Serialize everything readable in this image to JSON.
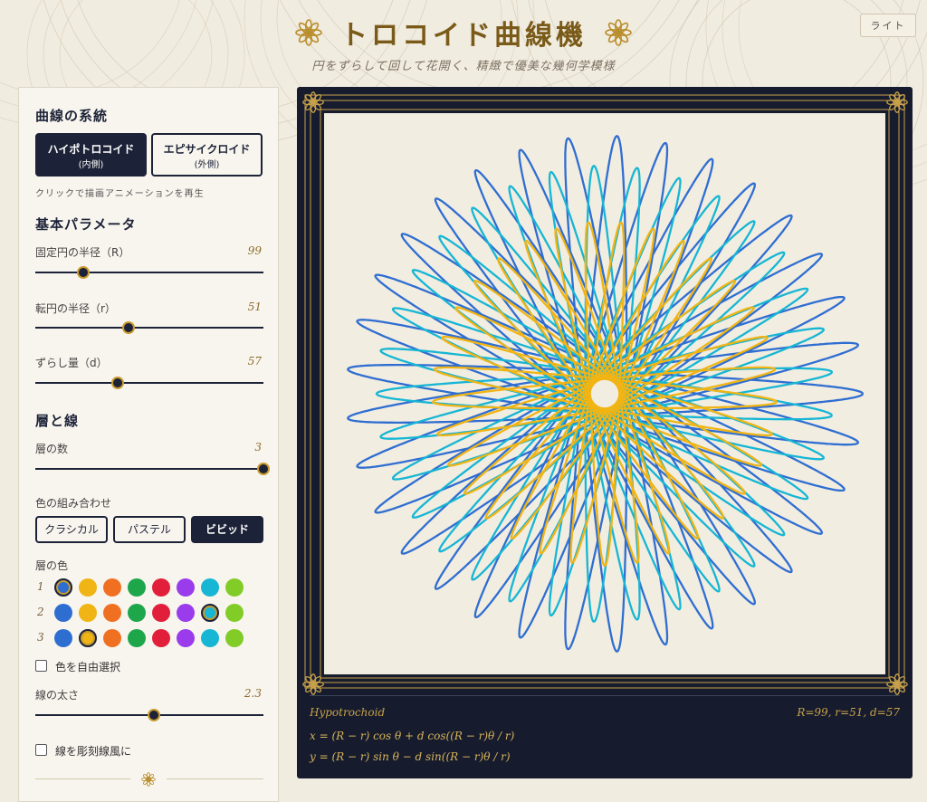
{
  "header": {
    "title": "トロコイド曲線機",
    "subtitle": "円をずらして回して花開く、精緻で優美な幾何学模様",
    "theme_button": "ライト"
  },
  "panel": {
    "family": {
      "title": "曲線の系統",
      "hypo_label": "ハイポトロコイド",
      "hypo_sub": "(内側)",
      "epi_label": "エピサイクロイド",
      "epi_sub": "(外側)",
      "selected": "hypo",
      "hint": "クリックで描画アニメーションを再生"
    },
    "basic": {
      "title": "基本パラメータ",
      "R_label": "固定円の半径（R）",
      "R_value": "99",
      "r_label": "転円の半径（r）",
      "r_value": "51",
      "d_label": "ずらし量（d）",
      "d_value": "57",
      "R_fraction": 0.21,
      "r_fraction": 0.41,
      "d_fraction": 0.36
    },
    "layers": {
      "title": "層と線",
      "count_label": "層の数",
      "count_value": "3",
      "count_fraction": 1.0,
      "combo_label": "色の組み合わせ",
      "combo_classic": "クラシカル",
      "combo_pastel": "パステル",
      "combo_vivid": "ビビッド",
      "combo_selected": "vivid",
      "colors_label": "層の色",
      "palette": [
        "#2f6ed1",
        "#f0b414",
        "#f07022",
        "#1ea64a",
        "#e21f3a",
        "#9a3bec",
        "#16b6d4",
        "#82cc28"
      ],
      "rows": [
        {
          "num": "1",
          "selected": 0
        },
        {
          "num": "2",
          "selected": 6
        },
        {
          "num": "3",
          "selected": 1
        }
      ],
      "free_color_label": "色を自由選択",
      "width_label": "線の太さ",
      "width_value": "2.3",
      "width_fraction": 0.52,
      "engrave_label": "線を彫刻線風に"
    }
  },
  "canvas": {
    "curve_name": "Hypotrochoid",
    "params": "R=99, r=51, d=57",
    "formula_x": "x = (R − r) cos θ + d cos((R − r)θ / r)",
    "formula_y": "y = (R − r) sin θ − d sin((R − r)θ / r)",
    "background": "#f2ede1",
    "frame_color": "#161c2e",
    "gold": "#c8a14a"
  }
}
